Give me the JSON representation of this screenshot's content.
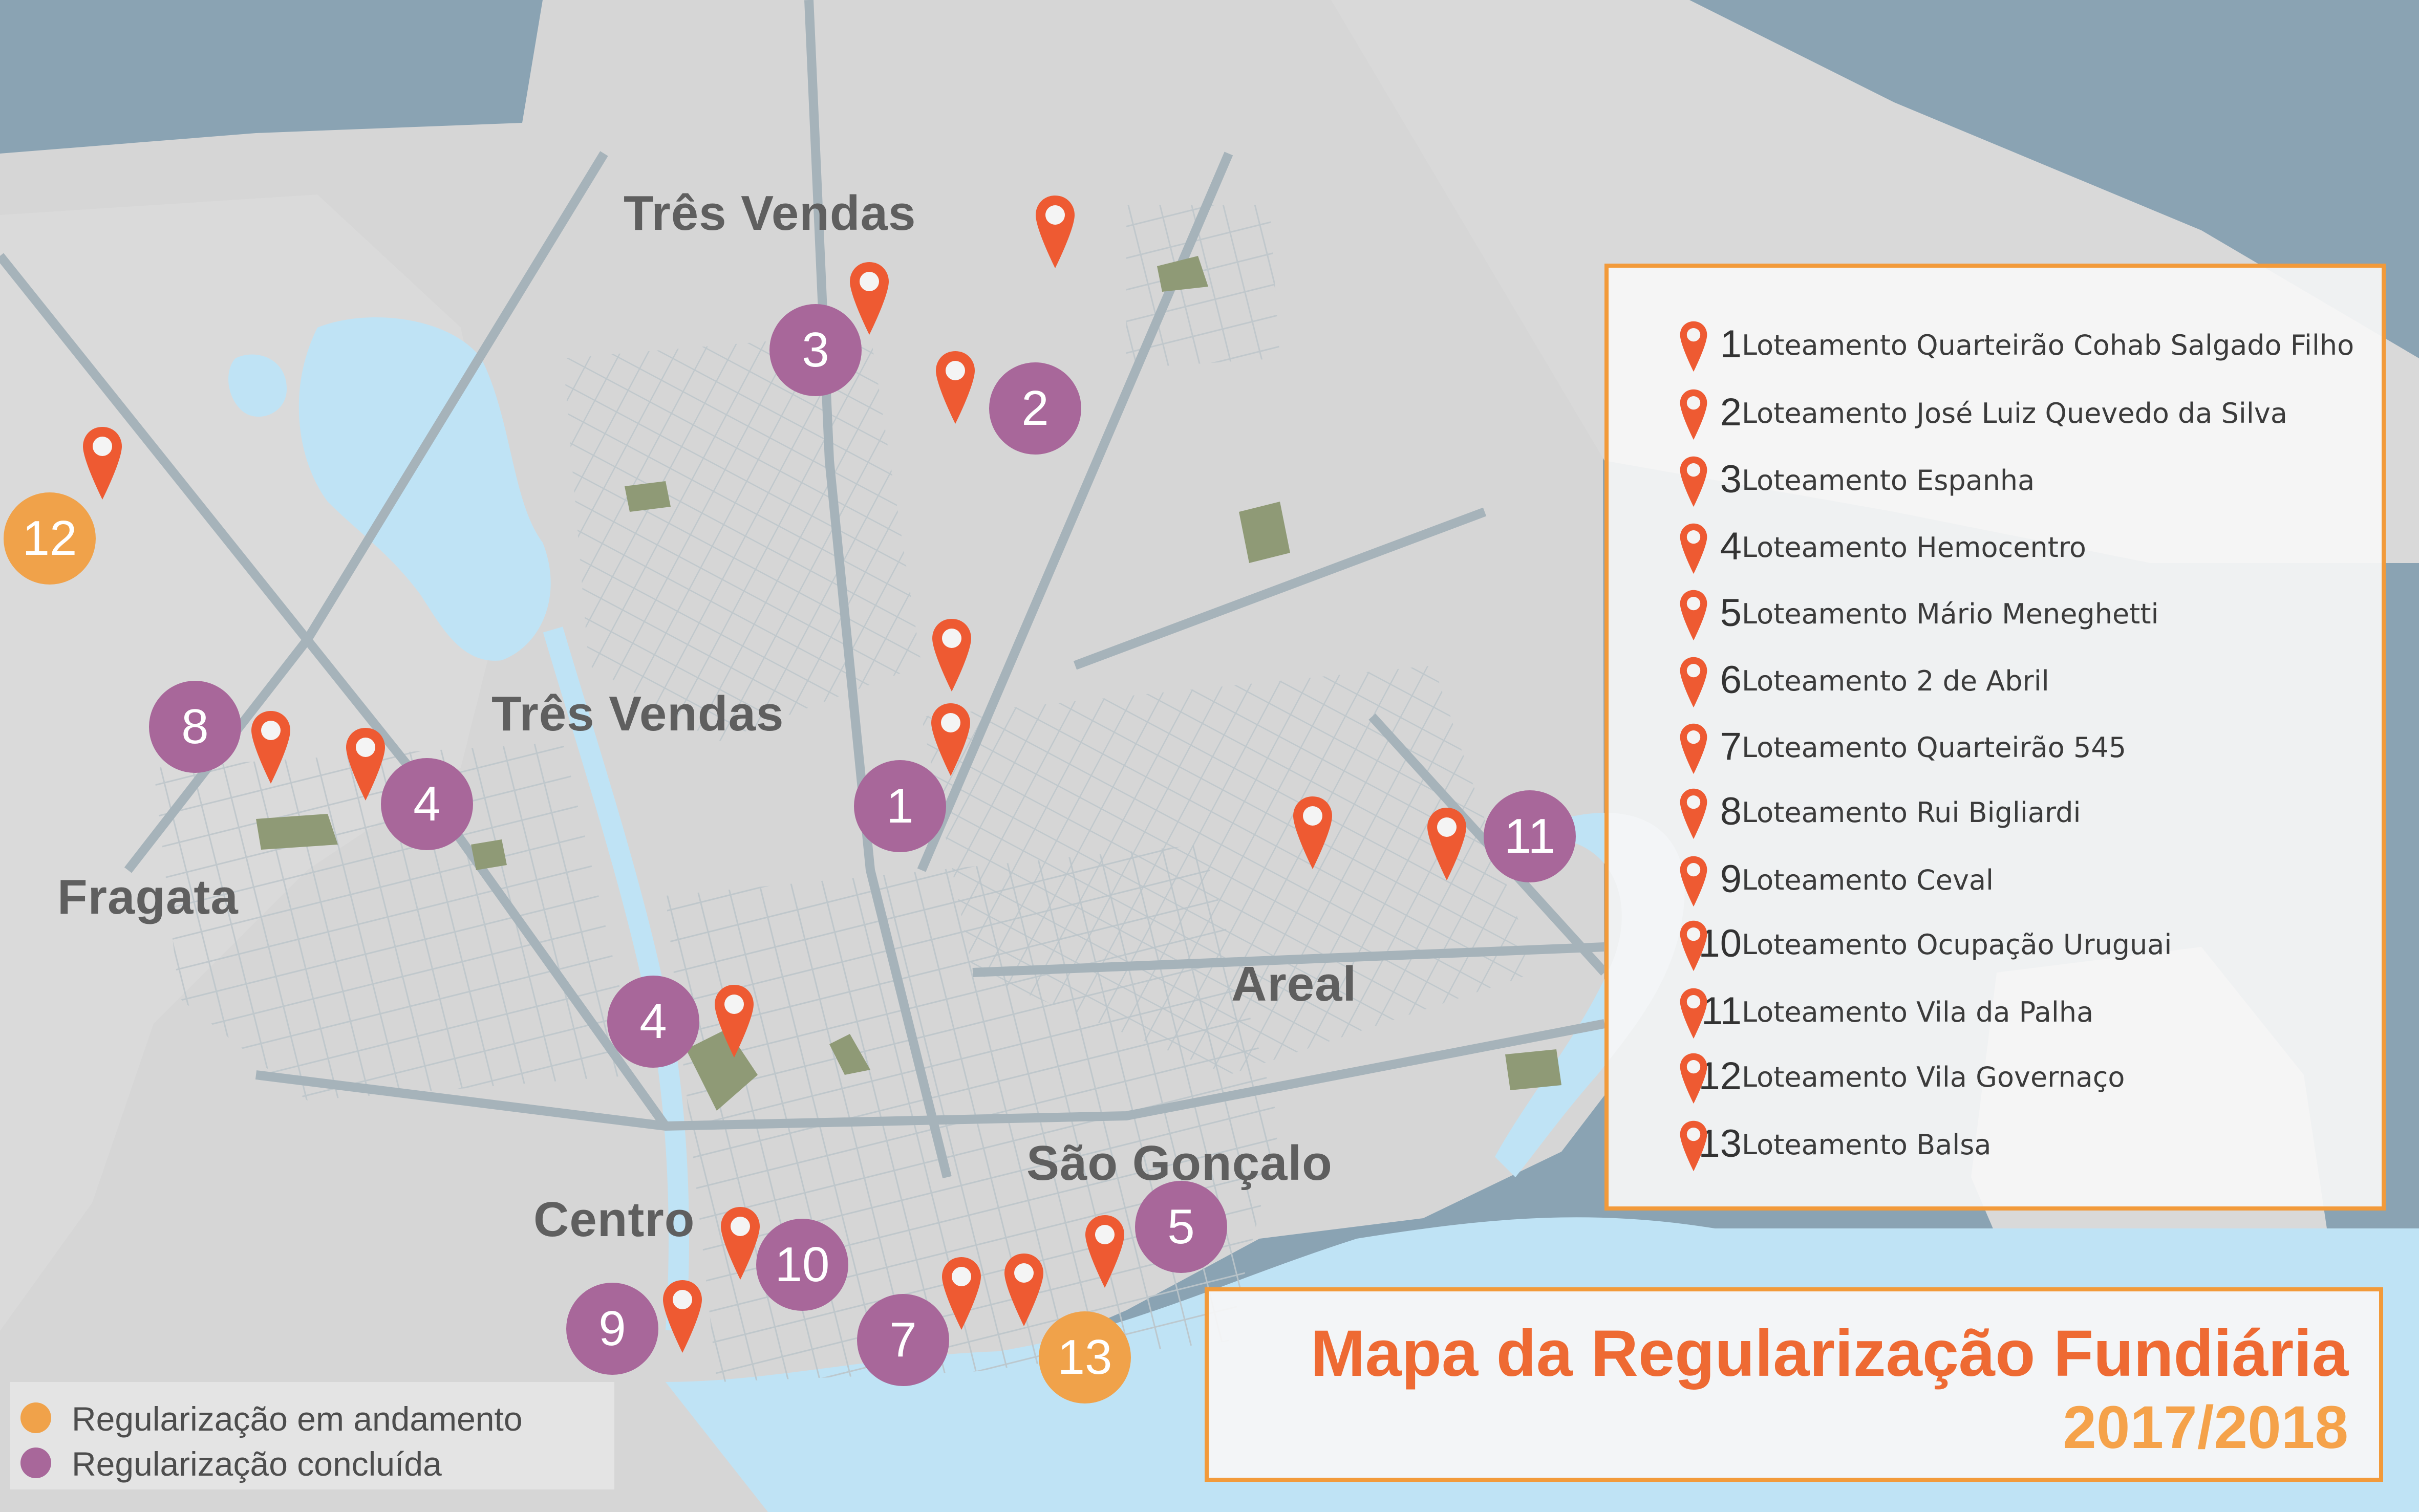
{
  "colors": {
    "water": "#8aa3b3",
    "land": "#d5d5d5",
    "lagoon": "#bfe3f5",
    "park": "#8f9a76",
    "road": "#b9c4ca",
    "pin": "#ee5a32",
    "completed": "#a8679a",
    "in_progress": "#f0a24a",
    "border_accent": "#f29a3a",
    "title": "#ee6a33",
    "year": "#f5a24a"
  },
  "title": {
    "main": "Mapa da Regularização Fundiária",
    "year": "2017/2018"
  },
  "neighborhoods": [
    {
      "id": "tres-vendas-north",
      "label": "Três Vendas"
    },
    {
      "id": "tres-vendas",
      "label": "Três Vendas"
    },
    {
      "id": "fragata",
      "label": "Fragata"
    },
    {
      "id": "areal",
      "label": "Areal"
    },
    {
      "id": "sao-goncalo",
      "label": "São Gonçalo"
    },
    {
      "id": "centro",
      "label": "Centro"
    }
  ],
  "markers": [
    {
      "num": "1",
      "status": "completed"
    },
    {
      "num": "2",
      "status": "completed"
    },
    {
      "num": "3",
      "status": "completed"
    },
    {
      "num": "4",
      "status": "completed"
    },
    {
      "num": "4",
      "status": "completed"
    },
    {
      "num": "5",
      "status": "completed"
    },
    {
      "num": "7",
      "status": "completed"
    },
    {
      "num": "8",
      "status": "completed"
    },
    {
      "num": "9",
      "status": "completed"
    },
    {
      "num": "10",
      "status": "completed"
    },
    {
      "num": "11",
      "status": "completed"
    },
    {
      "num": "12",
      "status": "in_progress"
    },
    {
      "num": "13",
      "status": "in_progress"
    }
  ],
  "legend": {
    "items": [
      {
        "num": "1",
        "label": "Loteamento Quarteirão Cohab Salgado Filho"
      },
      {
        "num": "2",
        "label": "Loteamento José Luiz Quevedo da Silva"
      },
      {
        "num": "3",
        "label": "Loteamento Espanha"
      },
      {
        "num": "4",
        "label": "Loteamento Hemocentro"
      },
      {
        "num": "5",
        "label": "Loteamento Mário Meneghetti"
      },
      {
        "num": "6",
        "label": "Loteamento 2 de Abril"
      },
      {
        "num": "7",
        "label": "Loteamento Quarteirão 545"
      },
      {
        "num": "8",
        "label": "Loteamento Rui Bigliardi"
      },
      {
        "num": "9",
        "label": "Loteamento Ceval"
      },
      {
        "num": "10",
        "label": "Loteamento Ocupação Uruguai"
      },
      {
        "num": "11",
        "label": "Loteamento Vila da Palha"
      },
      {
        "num": "12",
        "label": "Loteamento Vila Governaço"
      },
      {
        "num": "13",
        "label": "Loteamento Balsa"
      }
    ]
  },
  "status_key": {
    "in_progress": "Regularização em andamento",
    "completed": "Regularização concluída"
  }
}
